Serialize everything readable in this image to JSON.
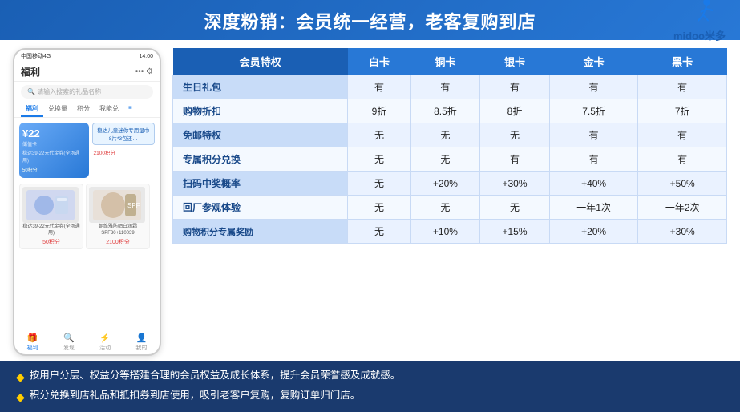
{
  "header": {
    "title": "深度粉销：会员统一经营，老客复购到店"
  },
  "logo": {
    "text": "midoo米多",
    "alt": "midoo logo"
  },
  "phone": {
    "status_bar": "中国移动4G",
    "time": "14:00",
    "nav_title": "福利",
    "search_placeholder": "请输入搜索的礼品名称",
    "tabs": [
      "福利",
      "兑换量",
      "积分",
      "我能兑"
    ],
    "active_tab": "福利",
    "card_price": "¥22",
    "card_subtitle": "储值卡",
    "card_points1": "50积分",
    "card_points2": "2100积分",
    "bottom_nav": [
      "福利",
      "发现",
      "活动",
      "我的"
    ]
  },
  "table": {
    "headers": [
      "会员特权",
      "白卡",
      "铜卡",
      "银卡",
      "金卡",
      "黑卡"
    ],
    "rows": [
      [
        "生日礼包",
        "有",
        "有",
        "有",
        "有",
        "有"
      ],
      [
        "购物折扣",
        "9折",
        "8.5折",
        "8折",
        "7.5折",
        "7折"
      ],
      [
        "免邮特权",
        "无",
        "无",
        "无",
        "有",
        "有"
      ],
      [
        "专属积分兑换",
        "无",
        "无",
        "有",
        "有",
        "有"
      ],
      [
        "扫码中奖概率",
        "无",
        "+20%",
        "+30%",
        "+40%",
        "+50%"
      ],
      [
        "回厂参观体验",
        "无",
        "无",
        "无",
        "一年1次",
        "一年2次"
      ],
      [
        "购物积分专属奖励",
        "无",
        "+10%",
        "+15%",
        "+20%",
        "+30%"
      ]
    ]
  },
  "footer": {
    "items": [
      "按用户分层、权益分等搭建合理的会员权益及成长体系，提升会员荣誉感及成就感。",
      "积分兑换到店礼品和抵扣券到店使用，吸引老客户复购，复购订单归门店。"
    ],
    "bullet": "◆"
  }
}
